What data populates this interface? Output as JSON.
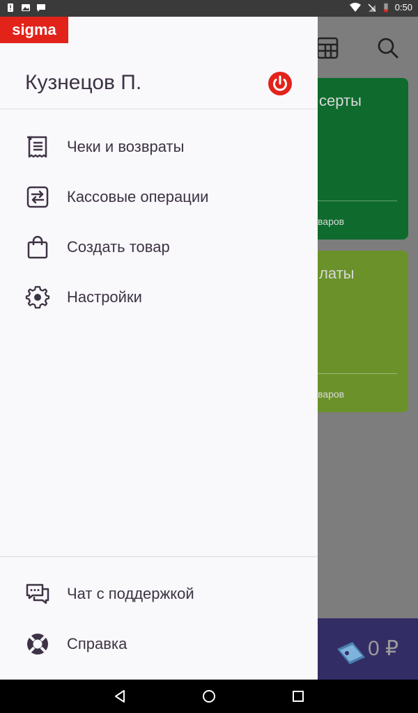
{
  "status_bar": {
    "time": "0:50"
  },
  "background": {
    "card1": {
      "title": "серты",
      "subtitle": "варов",
      "color": "#0e6b2d"
    },
    "card2": {
      "title": "латы",
      "subtitle": "варов",
      "color": "#6b922a"
    },
    "total": "0 ₽"
  },
  "drawer": {
    "logo": "sigma",
    "user_name": "Кузнецов П.",
    "menu": [
      {
        "label": "Чеки и возвраты",
        "icon": "receipt-icon"
      },
      {
        "label": "Кассовые операции",
        "icon": "swap-icon"
      },
      {
        "label": "Создать товар",
        "icon": "shopping-bag-icon"
      },
      {
        "label": "Настройки",
        "icon": "gear-icon"
      }
    ],
    "footer": [
      {
        "label": "Чат с поддержкой",
        "icon": "chat-icon"
      },
      {
        "label": "Справка",
        "icon": "lifebuoy-icon"
      }
    ]
  },
  "colors": {
    "accent": "#e2231a",
    "drawer_bg": "#f9f8fb",
    "text": "#3d3344",
    "bottom_bar": "#332d66"
  }
}
